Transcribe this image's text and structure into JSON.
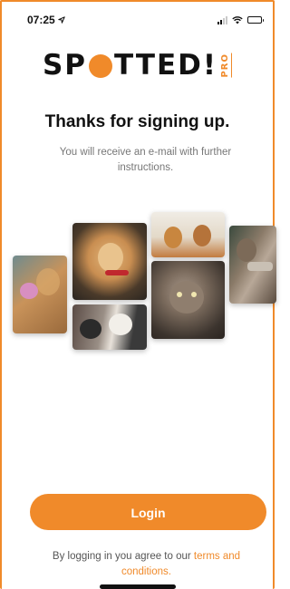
{
  "status_bar": {
    "time": "07:25",
    "location_icon": "location-arrow-icon",
    "signal_icon": "cellular-signal-icon",
    "wifi_icon": "wifi-icon",
    "battery_icon": "battery-icon"
  },
  "brand": {
    "logo_prefix": "SP",
    "logo_suffix": "TTED!",
    "logo_badge": "PRO",
    "accent_color": "#f08a2a"
  },
  "content": {
    "title": "Thanks for signing up.",
    "subtitle": "You will receive an e-mail with further instructions."
  },
  "photos": [
    {
      "name": "dog-with-flower-photo"
    },
    {
      "name": "golden-puppy-photo"
    },
    {
      "name": "kittens-photo"
    },
    {
      "name": "small-dogs-photo"
    },
    {
      "name": "tabby-cat-photo"
    },
    {
      "name": "cat-climbing-photo"
    }
  ],
  "actions": {
    "login_label": "Login"
  },
  "footer": {
    "terms_prefix": "By logging in you agree to our ",
    "terms_link": "terms and conditions",
    "terms_suffix": "."
  }
}
